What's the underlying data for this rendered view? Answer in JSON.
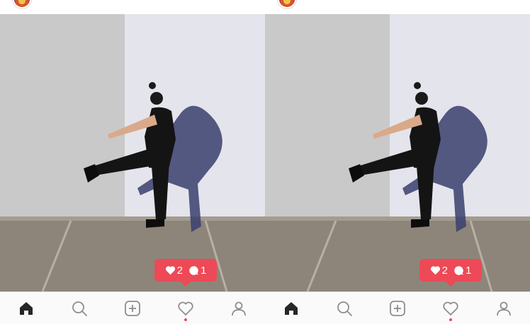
{
  "screens": [
    {
      "header": {
        "avatar_icon": "profile-avatar",
        "handle": ""
      },
      "notification": {
        "likes": "2",
        "comments": "1",
        "color": "#ed4956"
      },
      "tabs": [
        "home-icon",
        "search-icon",
        "add-post-icon",
        "activity-heart-icon",
        "profile-icon"
      ],
      "active_tab": "home-icon",
      "badge_tab": "activity-heart-icon"
    },
    {
      "header": {
        "avatar_icon": "profile-avatar",
        "handle": ""
      },
      "notification": {
        "likes": "2",
        "comments": "1",
        "color": "#ed4956"
      },
      "tabs": [
        "home-icon",
        "search-icon",
        "add-post-icon",
        "activity-heart-icon",
        "profile-icon"
      ],
      "active_tab": "home-icon",
      "badge_tab": "activity-heart-icon"
    }
  ],
  "colors": {
    "accent": "#ed4956",
    "icon": "#262626",
    "icon_muted": "#8e8e8e",
    "tabbar_bg": "#fafafa"
  }
}
